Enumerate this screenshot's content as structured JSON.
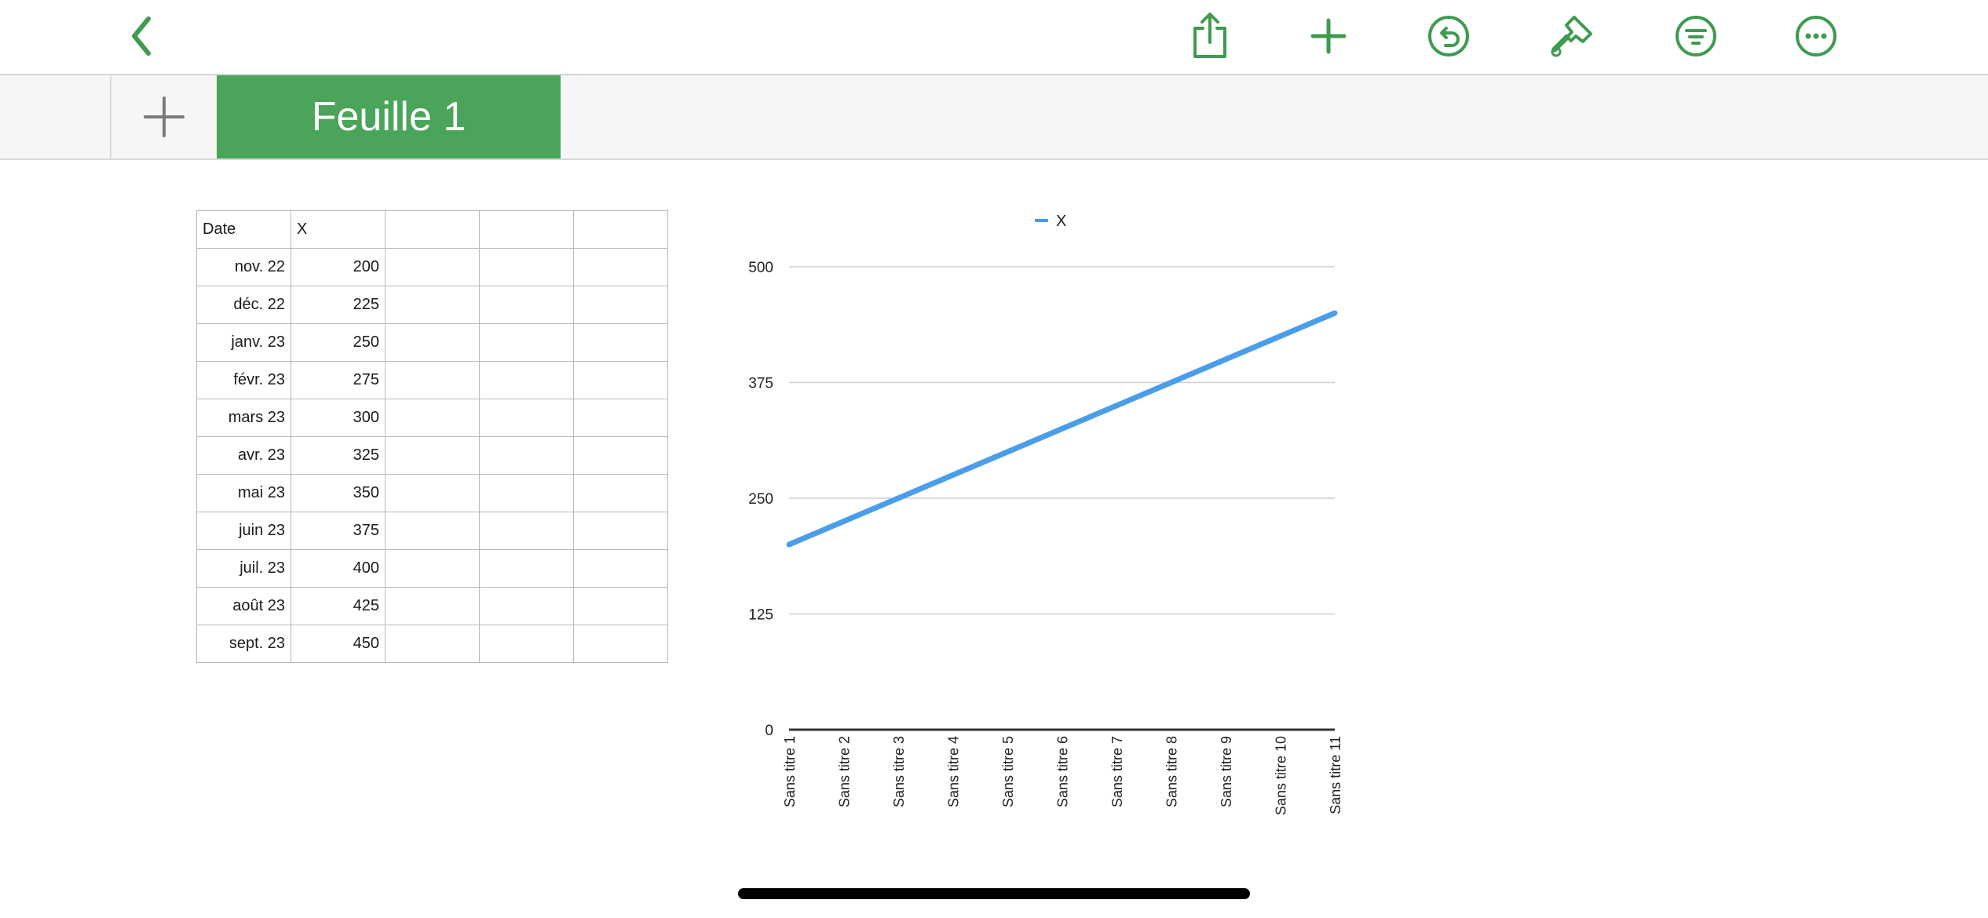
{
  "colors": {
    "accent": "#3f9b4f",
    "sheet_tab_bg": "#4aa55a",
    "series_line": "#4a9ee9"
  },
  "toolbar": {
    "icons": [
      "chevron-left-icon",
      "share-icon",
      "plus-icon",
      "undo-icon",
      "paintbrush-icon",
      "filter-icon",
      "more-icon"
    ]
  },
  "tabs": {
    "active_sheet_label": "Feuille 1"
  },
  "table": {
    "headers": [
      "Date",
      "X",
      "",
      "",
      ""
    ],
    "rows": [
      [
        "nov. 22",
        "200"
      ],
      [
        "déc. 22",
        "225"
      ],
      [
        "janv. 23",
        "250"
      ],
      [
        "févr. 23",
        "275"
      ],
      [
        "mars 23",
        "300"
      ],
      [
        "avr. 23",
        "325"
      ],
      [
        "mai 23",
        "350"
      ],
      [
        "juin 23",
        "375"
      ],
      [
        "juil. 23",
        "400"
      ],
      [
        "août 23",
        "425"
      ],
      [
        "sept. 23",
        "450"
      ]
    ]
  },
  "chart_data": {
    "type": "line",
    "categories": [
      "Sans titre 1",
      "Sans titre 2",
      "Sans titre 3",
      "Sans titre 4",
      "Sans titre 5",
      "Sans titre 6",
      "Sans titre 7",
      "Sans titre 8",
      "Sans titre 9",
      "Sans titre 10",
      "Sans titre 11"
    ],
    "series": [
      {
        "name": "X",
        "values": [
          200,
          225,
          250,
          275,
          300,
          325,
          350,
          375,
          400,
          425,
          450
        ]
      }
    ],
    "yticks": [
      "0",
      "125",
      "250",
      "375",
      "500"
    ],
    "ylim": [
      0,
      500
    ],
    "legend": "top-center",
    "grid": true
  }
}
